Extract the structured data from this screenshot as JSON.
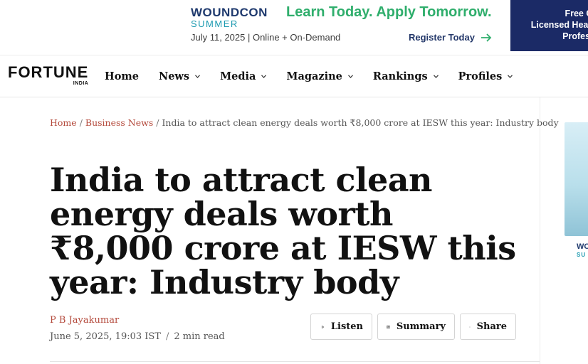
{
  "ad": {
    "logo_main": "WOUNDCON",
    "logo_sub": "SUMMER",
    "tagline": "Learn Today. Apply Tomorrow.",
    "date": "July 11, 2025 | Online + On-Demand",
    "cta": "Register Today",
    "side_line1": "Free Ch",
    "side_line2": "Licensed Healt",
    "side_line3": "Profess",
    "colors": {
      "navy": "#1b2a66",
      "green": "#2fae6c",
      "teal": "#1c9ab0"
    }
  },
  "nav": {
    "brand": "FORTUNE",
    "brand_sub": "INDIA",
    "items": [
      {
        "label": "Home",
        "dropdown": false
      },
      {
        "label": "News",
        "dropdown": true
      },
      {
        "label": "Media",
        "dropdown": true
      },
      {
        "label": "Magazine",
        "dropdown": true
      },
      {
        "label": "Rankings",
        "dropdown": true
      },
      {
        "label": "Profiles",
        "dropdown": true
      }
    ]
  },
  "breadcrumb": {
    "home": "Home",
    "section": "Business News",
    "current": "India to attract clean energy deals worth ₹8,000 crore at IESW this year: Industry body",
    "separator": "/"
  },
  "article": {
    "headline": "India to attract clean energy deals worth ₹8,000 crore at IESW this year: Industry body",
    "author": "P B Jayakumar",
    "date": "June 5, 2025, 19:03 IST",
    "read_time": "2 min read",
    "meta_separator": "/"
  },
  "actions": {
    "listen": "Listen",
    "summary": "Summary",
    "share": "Share"
  },
  "side_ad": {
    "text1": "WO",
    "text2": "SU"
  },
  "accent_color": "#b44a3c"
}
